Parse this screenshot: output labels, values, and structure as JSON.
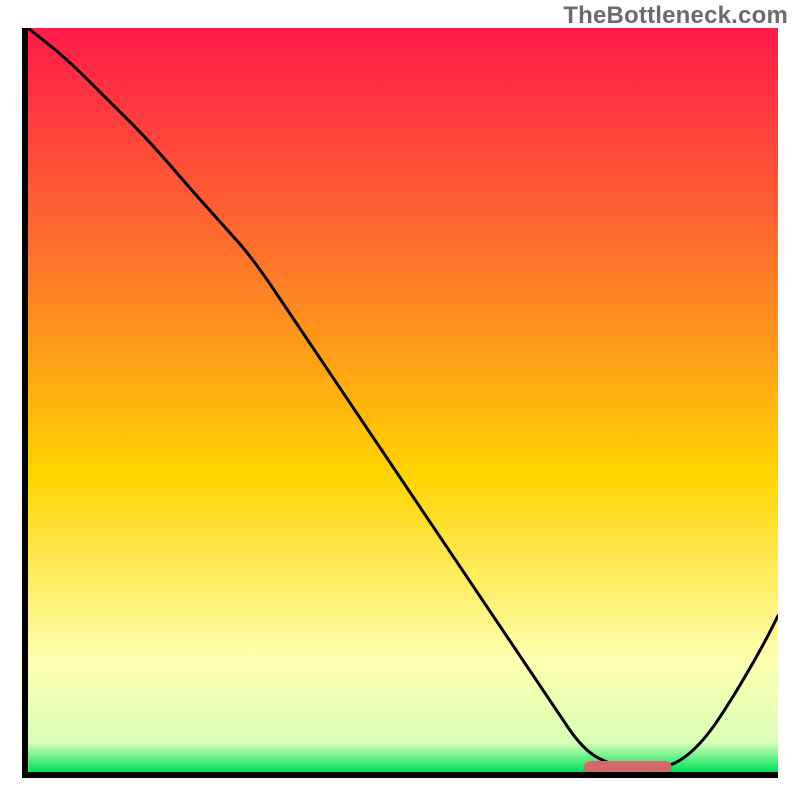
{
  "watermark": "TheBottleneck.com",
  "colors": {
    "gradient_top": "#ff1a4a",
    "gradient_mid1": "#ff6a2f",
    "gradient_mid2": "#ffd400",
    "gradient_pale": "#ffffb0",
    "gradient_bottom": "#00e05a",
    "axis": "#000000",
    "curve": "#000000",
    "marker": "#d36a6a"
  },
  "chart_description": "Single curved black line over a vertical red→orange→yellow→green gradient, with a short salmon-pink marker segment in the trough near the bottom-right.",
  "chart_data": {
    "type": "line",
    "title": "",
    "xlabel": "",
    "ylabel": "",
    "xlim": [
      0,
      100
    ],
    "ylim": [
      0,
      100
    ],
    "series": [
      {
        "name": "curve",
        "x": [
          0,
          5,
          10,
          16,
          22,
          26,
          30,
          36,
          42,
          48,
          54,
          60,
          66,
          70,
          74,
          78,
          82,
          86,
          90,
          94,
          98,
          100
        ],
        "values": [
          100,
          96,
          91,
          85,
          78,
          73.5,
          69,
          60,
          51,
          42,
          33,
          24,
          15,
          9,
          3,
          0.8,
          0.5,
          0.7,
          4,
          10,
          17,
          21
        ]
      }
    ],
    "marker_segment": {
      "x_start": 75,
      "x_end": 85,
      "y": 0.6
    },
    "gradient_stops": [
      {
        "pct": 0,
        "color": "#ff1a4a"
      },
      {
        "pct": 28,
        "color": "#ff6a2f"
      },
      {
        "pct": 60,
        "color": "#ffd400"
      },
      {
        "pct": 85,
        "color": "#ffffb0"
      },
      {
        "pct": 96,
        "color": "#d9ffb8"
      },
      {
        "pct": 100,
        "color": "#00e05a"
      }
    ]
  }
}
